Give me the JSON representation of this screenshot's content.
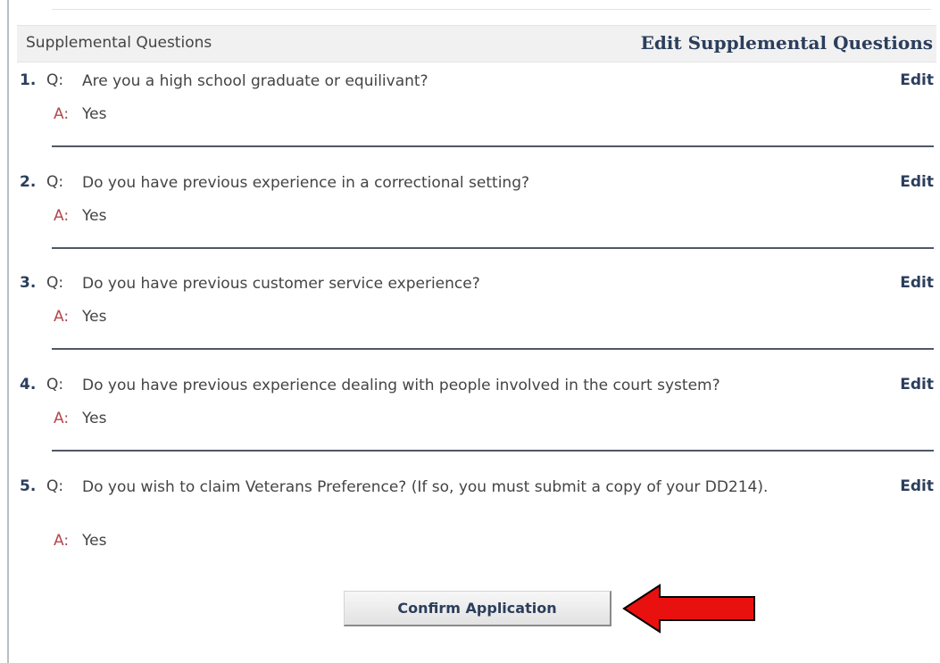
{
  "section": {
    "title": "Supplemental Questions",
    "edit_label": "Edit Supplemental Questions"
  },
  "questions": [
    {
      "number": "1.",
      "q_prefix": "Q:",
      "question": "Are you a high school graduate or equilivant?",
      "a_prefix": "A:",
      "answer": "Yes",
      "edit_label": "Edit"
    },
    {
      "number": "2.",
      "q_prefix": "Q:",
      "question": "Do you have previous experience in a correctional setting?",
      "a_prefix": "A:",
      "answer": "Yes",
      "edit_label": "Edit"
    },
    {
      "number": "3.",
      "q_prefix": "Q:",
      "question": "Do you have previous customer service experience?",
      "a_prefix": "A:",
      "answer": "Yes",
      "edit_label": "Edit"
    },
    {
      "number": "4.",
      "q_prefix": "Q:",
      "question": "Do you have previous experience dealing with people involved in the court system?",
      "a_prefix": "A:",
      "answer": "Yes",
      "edit_label": "Edit"
    },
    {
      "number": "5.",
      "q_prefix": "Q:",
      "question": "Do you wish to claim Veterans Preference? (If so, you must submit a copy of your DD214).",
      "a_prefix": "A:",
      "answer": "Yes",
      "edit_label": "Edit"
    }
  ],
  "confirm_label": "Confirm Application",
  "colors": {
    "link": "#2b3e5c",
    "answer_prefix": "#b0484d",
    "arrow_fill": "#e8110f"
  },
  "annotation": {
    "icon": "red-arrow-left-icon"
  }
}
